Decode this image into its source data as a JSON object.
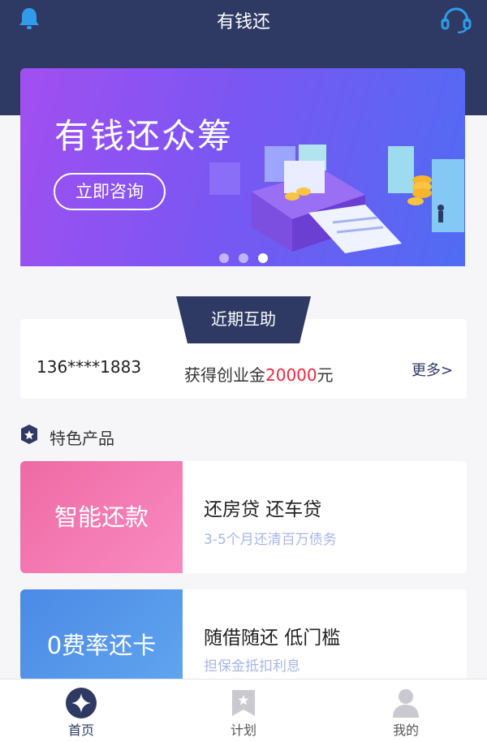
{
  "header": {
    "title": "有钱还",
    "left_icon": "bell-icon",
    "right_icon": "headset-icon"
  },
  "banner": {
    "title": "有钱还众筹",
    "button_label": "立即咨询",
    "slides": 3,
    "active_slide": 3
  },
  "recent_help": {
    "tab_label": "近期互助",
    "phone": "136****1883",
    "award_prefix": "获得创业金",
    "award_amount": "20000",
    "award_suffix": "元",
    "more_label": "更多>"
  },
  "featured": {
    "section_title": "特色产品",
    "section_icon": "star-badge-icon",
    "products": [
      {
        "badge": "智能还款",
        "title": "还房贷 还车贷",
        "subtitle": "3-5个月还清百万债务"
      },
      {
        "badge": "0费率还卡",
        "title": "随借随还 低门槛",
        "subtitle": "担保金抵扣利息"
      }
    ]
  },
  "tabbar": {
    "items": [
      {
        "label": "首页",
        "icon": "home-diamond-icon",
        "active": true
      },
      {
        "label": "计划",
        "icon": "bookmark-star-icon",
        "active": false
      },
      {
        "label": "我的",
        "icon": "user-icon",
        "active": false
      }
    ]
  },
  "colors": {
    "header_bg": "#2e3a63",
    "accent_red": "#f0263f",
    "product1": "#ef6aa5",
    "product2": "#4b8ae6"
  }
}
